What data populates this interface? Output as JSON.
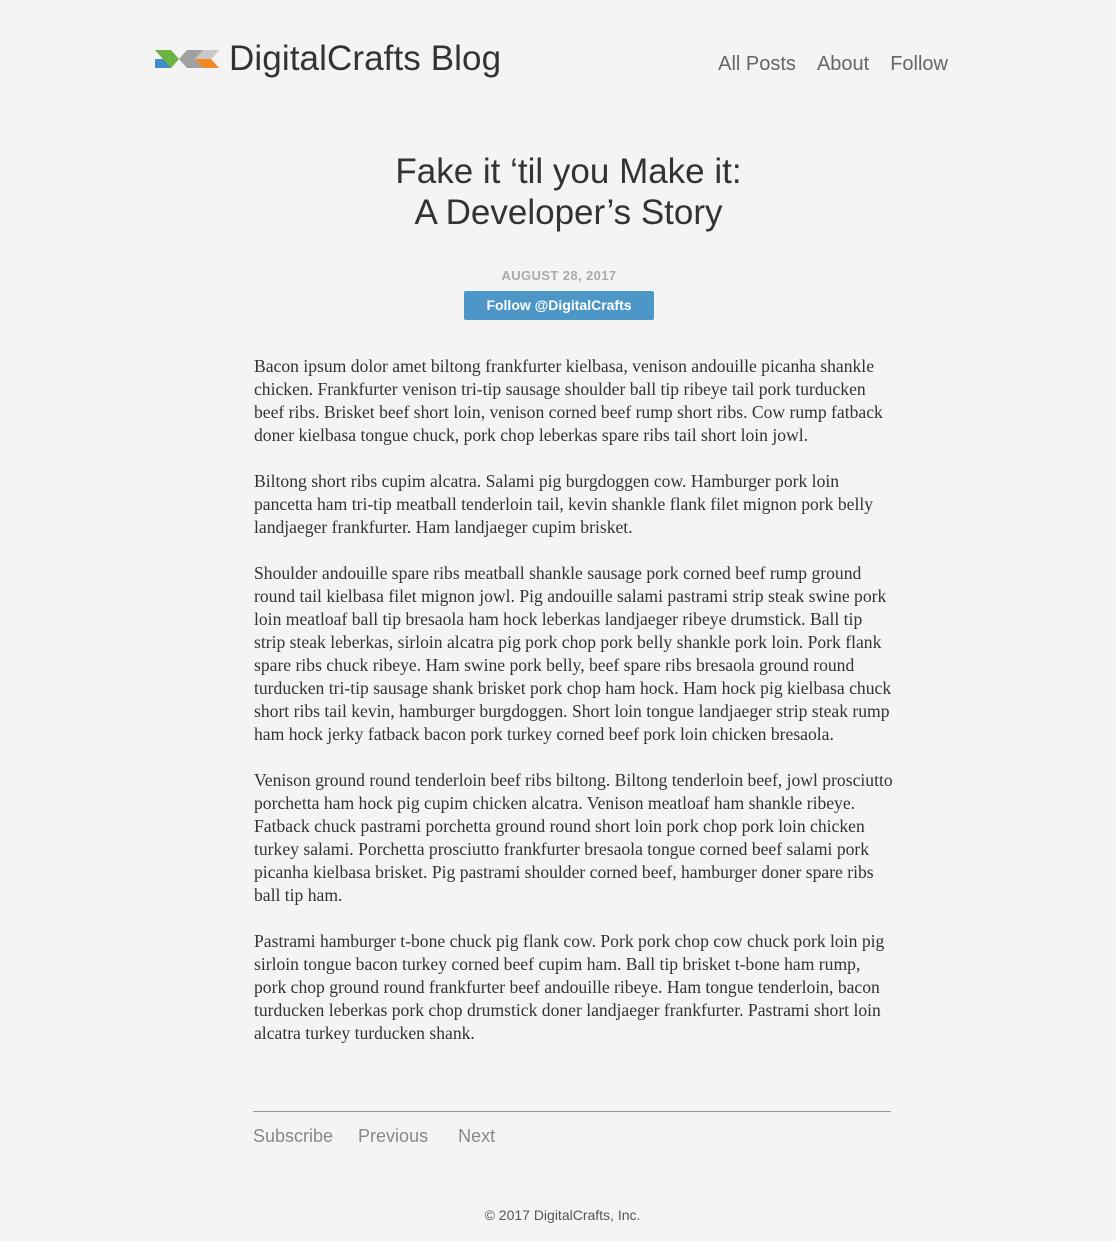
{
  "header": {
    "site_title": "DigitalCrafts Blog",
    "logo_colors": [
      "#3d8ec9",
      "#6db33f",
      "#a0a0a0",
      "#f08a24"
    ],
    "nav": [
      {
        "label": "All Posts"
      },
      {
        "label": "About"
      },
      {
        "label": "Follow"
      }
    ]
  },
  "post": {
    "title_line1": "Fake it ‘til you Make it:",
    "title_line2": "A Developer’s Story",
    "date": "AUGUST 28, 2017",
    "follow_button": "Follow @DigitalCrafts",
    "follow_color": "#4c96c8",
    "paragraphs": [
      "Bacon ipsum dolor amet biltong frankfurter kielbasa, venison andouille picanha shankle chicken. Frankfurter venison tri-tip sausage shoulder ball tip ribeye tail pork turducken beef ribs. Brisket beef short loin, venison corned beef rump short ribs. Cow rump fatback doner kielbasa tongue chuck, pork chop leberkas spare ribs tail short loin jowl.",
      "Biltong short ribs cupim alcatra. Salami pig burgdoggen cow. Hamburger pork loin pancetta ham tri-tip meatball tenderloin tail, kevin shankle flank filet mignon pork belly landjaeger frankfurter. Ham landjaeger cupim brisket.",
      "Shoulder andouille spare ribs meatball shankle sausage pork corned beef rump ground round tail kielbasa filet mignon jowl. Pig andouille salami pastrami strip steak swine pork loin meatloaf ball tip bresaola ham hock leberkas landjaeger ribeye drumstick. Ball tip strip steak leberkas, sirloin alcatra pig pork chop pork belly shankle pork loin. Pork flank spare ribs chuck ribeye. Ham swine pork belly, beef spare ribs bresaola ground round turducken tri-tip sausage shank brisket pork chop ham hock. Ham hock pig kielbasa chuck short ribs tail kevin, hamburger burgdoggen. Short loin tongue landjaeger strip steak rump ham hock jerky fatback bacon pork turkey corned beef pork loin chicken bresaola.",
      "Venison ground round tenderloin beef ribs biltong. Biltong tenderloin beef, jowl prosciutto porchetta ham hock pig cupim chicken alcatra. Venison meatloaf ham shankle ribeye. Fatback chuck pastrami porchetta ground round short loin pork chop pork loin chicken turkey salami. Porchetta prosciutto frankfurter bresaola tongue corned beef salami pork picanha kielbasa brisket. Pig pastrami shoulder corned beef, hamburger doner spare ribs ball tip ham.",
      "Pastrami hamburger t-bone chuck pig flank cow. Pork pork chop cow chuck pork loin pig sirloin tongue bacon turkey corned beef cupim ham. Ball tip brisket t-bone ham rump, pork chop ground round frankfurter beef andouille ribeye. Ham tongue tenderloin, bacon turducken leberkas pork chop drumstick doner landjaeger frankfurter. Pastrami short loin alcatra turkey turducken shank."
    ]
  },
  "footer": {
    "subscribe": "Subscribe",
    "previous": "Previous",
    "next": "Next",
    "copyright": "© 2017 DigitalCrafts, Inc."
  }
}
